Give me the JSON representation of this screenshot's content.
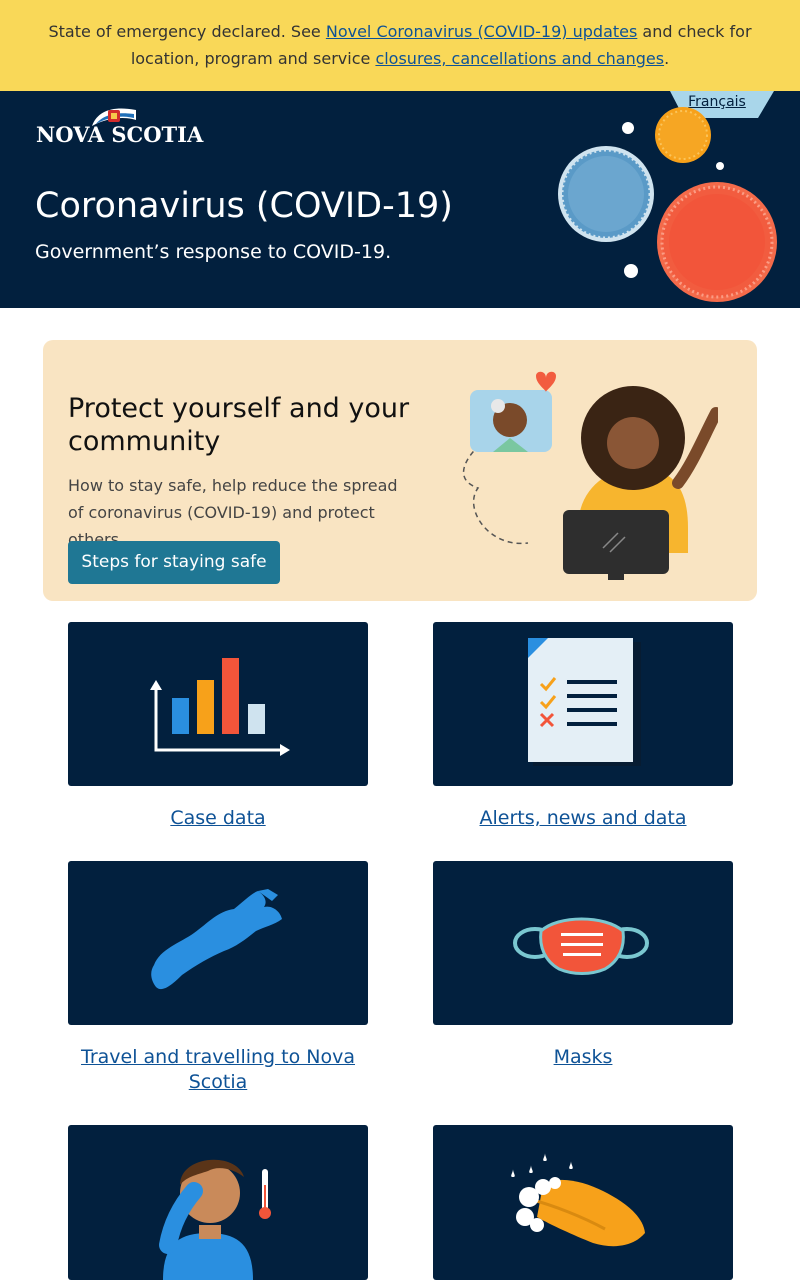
{
  "alert": {
    "text_before": "State of emergency declared. See ",
    "link1": "Novel Coronavirus (COVID-19) updates",
    "text_middle": " and check for location, program and service ",
    "link2": "closures, cancellations and changes",
    "text_after": "."
  },
  "header": {
    "language_link": "Français",
    "logo_text": "NOVA SCOTIA",
    "title": "Coronavirus (COVID-19)",
    "subtitle": "Government’s response to COVID-19."
  },
  "protect": {
    "heading": "Protect yourself and your community",
    "description": "How to stay safe, help reduce the spread of coronavirus (COVID-19) and protect others.",
    "button": "Steps for staying safe"
  },
  "tiles": [
    {
      "label": "Case data",
      "icon": "bar-chart-icon"
    },
    {
      "label": "Alerts, news and data",
      "icon": "checklist-document-icon"
    },
    {
      "label": "Travel and travelling to Nova Scotia",
      "icon": "nova-scotia-map-icon"
    },
    {
      "label": "Masks",
      "icon": "face-mask-icon"
    },
    {
      "label": "",
      "icon": "sick-person-icon"
    },
    {
      "label": "",
      "icon": "handwashing-icon"
    }
  ],
  "colors": {
    "alert_bg": "#f9d858",
    "header_bg": "#02203e",
    "link": "#0e5296",
    "button": "#1f7794",
    "protect_bg": "#f9e4c2"
  }
}
